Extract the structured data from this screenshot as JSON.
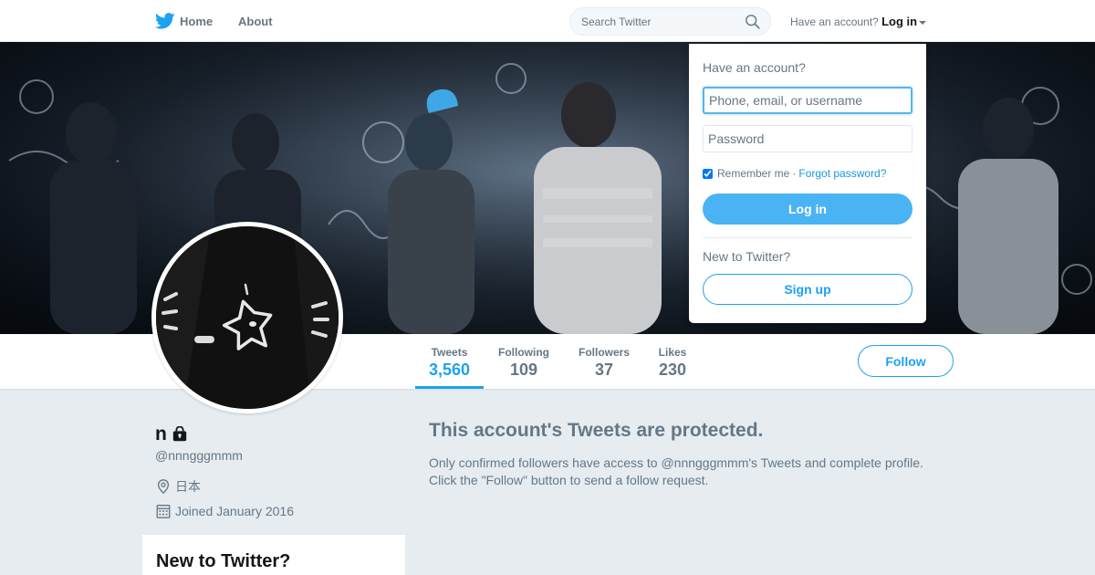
{
  "nav": {
    "home_label": "Home",
    "about_label": "About",
    "search_placeholder": "Search Twitter",
    "have_account": "Have an account?",
    "login_label": "Log in",
    "brand_color": "#1da1f2"
  },
  "profile_nav": {
    "stats": [
      {
        "label": "Tweets",
        "value": "3,560"
      },
      {
        "label": "Following",
        "value": "109"
      },
      {
        "label": "Followers",
        "value": "37"
      },
      {
        "label": "Likes",
        "value": "230"
      }
    ],
    "follow_label": "Follow"
  },
  "profile": {
    "name": "n",
    "screen_name": "@nnngggmmm",
    "location": "日本",
    "joined": "Joined January 2016"
  },
  "sidebar": {
    "signup_heading": "New to Twitter?"
  },
  "protected": {
    "title": "This account's Tweets are protected.",
    "body_line1": "Only confirmed followers have access to @nnngggmmm's Tweets and complete profile.",
    "body_line2": "Click the \"Follow\" button to send a follow request."
  },
  "login_dropdown": {
    "heading": "Have an account?",
    "username_placeholder": "Phone, email, or username",
    "password_placeholder": "Password",
    "remember_label": "Remember me",
    "separator": "·",
    "forgot_label": "Forgot password?",
    "login_button": "Log in",
    "new_label": "New to Twitter?",
    "signup_button": "Sign up"
  }
}
